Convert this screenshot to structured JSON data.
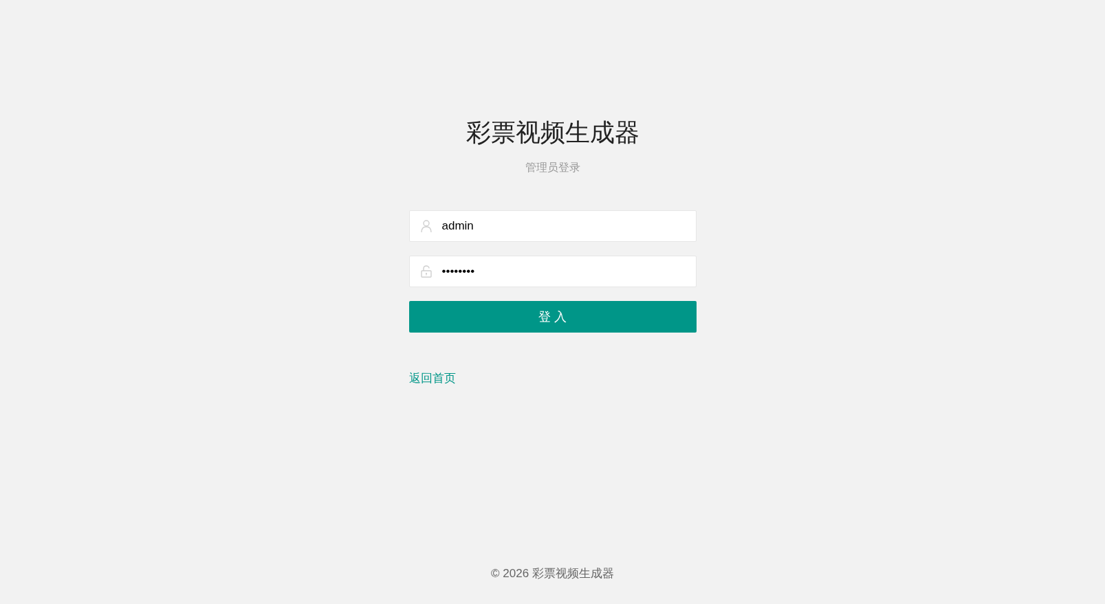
{
  "title": "彩票视频生成器",
  "subtitle": "管理员登录",
  "form": {
    "fields": [
      {
        "kind": "username",
        "value": "admin"
      },
      {
        "kind": "password",
        "value": "••••••••"
      }
    ],
    "submit_button": "登 入"
  },
  "back_link": "返回首页",
  "footer": "© 2026 彩票视频生成器"
}
